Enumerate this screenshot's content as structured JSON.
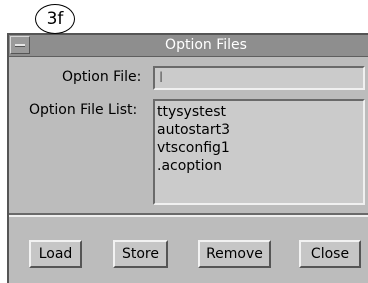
{
  "annotation": {
    "label": "3f"
  },
  "window": {
    "title": "Option Files"
  },
  "form": {
    "option_file_label": "Option File:",
    "option_file_value": "",
    "option_file_list_label": "Option File List:",
    "option_files": [
      "ttysystest",
      "autostart3",
      "vtsconfig1",
      ".acoption"
    ]
  },
  "buttons": {
    "load": "Load",
    "store": "Store",
    "remove": "Remove",
    "close": "Close"
  }
}
